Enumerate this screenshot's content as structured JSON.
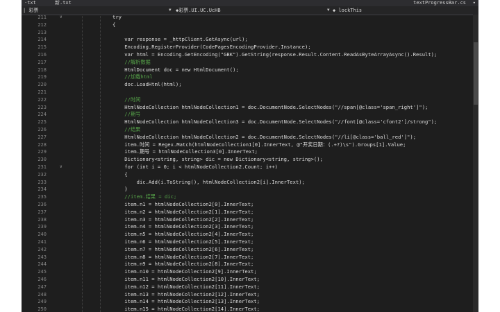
{
  "tabs": {
    "left1": "·txt",
    "left2": "新.txt",
    "right": "textProgressBar.cs"
  },
  "navbar": {
    "left": "| 彩票",
    "middle": "◆彩票.UI.UC.UcHB",
    "right": "◆ lockThis"
  },
  "lines": [
    {
      "n": "211",
      "code": "try"
    },
    {
      "n": "212",
      "code": "{"
    },
    {
      "n": "213",
      "code": ""
    },
    {
      "n": "214",
      "code": "    var response = _httpClient.GetAsync(url);"
    },
    {
      "n": "215",
      "code": "    Encoding.RegisterProvider(CodePagesEncodingProvider.Instance);"
    },
    {
      "n": "216",
      "code": "    var html = Encoding.GetEncoding(\"GBK\").GetString(response.Result.Content.ReadAsByteArrayAsync().Result);"
    },
    {
      "n": "217",
      "code": "    //解析数据"
    },
    {
      "n": "218",
      "code": "    HtmlDocument doc = new HtmlDocument();"
    },
    {
      "n": "219",
      "code": "    //加载html"
    },
    {
      "n": "220",
      "code": "    doc.LoadHtml(html);"
    },
    {
      "n": "221",
      "code": ""
    },
    {
      "n": "222",
      "code": "    //时间"
    },
    {
      "n": "223",
      "code": "    HtmlNodeCollection htmlNodeCollection1 = doc.DocumentNode.SelectNodes(\"//span[@class='span_right']\");"
    },
    {
      "n": "224",
      "code": "    //期号"
    },
    {
      "n": "225",
      "code": "    HtmlNodeCollection htmlNodeCollection3 = doc.DocumentNode.SelectNodes(\"//font[@class='cfont2']/strong\");"
    },
    {
      "n": "226",
      "code": "    //结果"
    },
    {
      "n": "227",
      "code": "    HtmlNodeCollection htmlNodeCollection2 = doc.DocumentNode.SelectNodes(\"//li[@class='ball_red']\");"
    },
    {
      "n": "228",
      "code": "    item.时间 = Regex.Match(htmlNodeCollection1[0].InnerText, @\"开奖日期：(.+?)\\s\").Groups[1].Value;"
    },
    {
      "n": "229",
      "code": "    item.期号 = htmlNodeCollection3[0].InnerText;"
    },
    {
      "n": "230",
      "code": "    Dictionary<string, string> dic = new Dictionary<string, string>();"
    },
    {
      "n": "231",
      "code": "    for (int i = 0; i < htmlNodeCollection2.Count; i++)"
    },
    {
      "n": "232",
      "code": "    {"
    },
    {
      "n": "233",
      "code": "        dic.Add(i.ToString(), htmlNodeCollection2[i].InnerText);"
    },
    {
      "n": "234",
      "code": "    }"
    },
    {
      "n": "235",
      "code": "    //item.结果 = dic;"
    },
    {
      "n": "236",
      "code": "    item.n1 = htmlNodeCollection2[0].InnerText;"
    },
    {
      "n": "237",
      "code": "    item.n2 = htmlNodeCollection2[1].InnerText;"
    },
    {
      "n": "238",
      "code": "    item.n3 = htmlNodeCollection2[2].InnerText;"
    },
    {
      "n": "239",
      "code": "    item.n4 = htmlNodeCollection2[3].InnerText;"
    },
    {
      "n": "240",
      "code": "    item.n5 = htmlNodeCollection2[4].InnerText;"
    },
    {
      "n": "241",
      "code": "    item.n6 = htmlNodeCollection2[5].InnerText;"
    },
    {
      "n": "242",
      "code": "    item.n7 = htmlNodeCollection2[6].InnerText;"
    },
    {
      "n": "243",
      "code": "    item.n8 = htmlNodeCollection2[7].InnerText;"
    },
    {
      "n": "244",
      "code": "    item.n9 = htmlNodeCollection2[8].InnerText;"
    },
    {
      "n": "245",
      "code": "    item.n10 = htmlNodeCollection2[9].InnerText;"
    },
    {
      "n": "246",
      "code": "    item.n11 = htmlNodeCollection2[10].InnerText;"
    },
    {
      "n": "247",
      "code": "    item.n12 = htmlNodeCollection2[11].InnerText;"
    },
    {
      "n": "248",
      "code": "    item.n13 = htmlNodeCollection2[12].InnerText;"
    },
    {
      "n": "249",
      "code": "    item.n14 = htmlNodeCollection2[13].InnerText;"
    },
    {
      "n": "250",
      "code": "    item.n15 = htmlNodeCollection2[14].InnerText;"
    }
  ]
}
